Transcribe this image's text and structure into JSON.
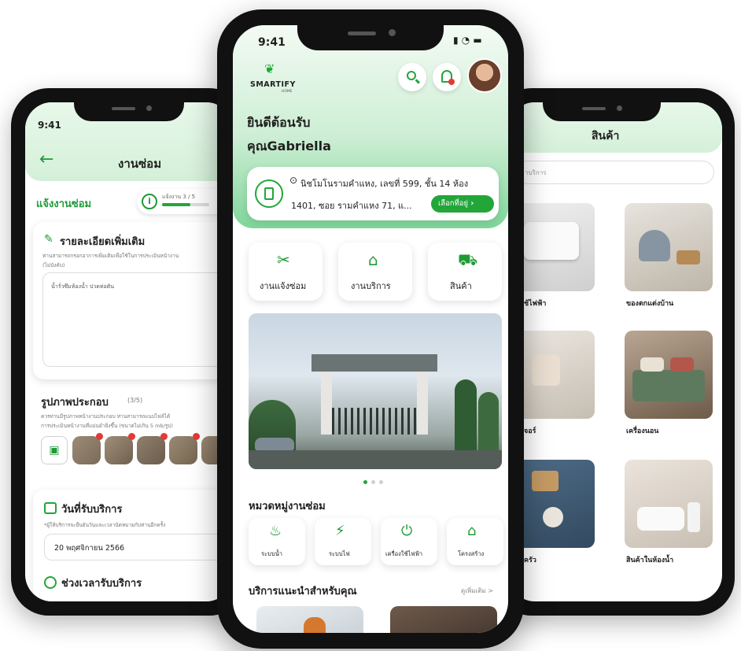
{
  "brand": {
    "name": "SMARTIFY",
    "sub": "HOME",
    "green": "#22a63a",
    "light": "#dff5e3"
  },
  "left": {
    "time": "9:41",
    "title": "งานซ่อม",
    "section": "แจ้งงานซ่อม",
    "step": "แจ้งงาน 3 / 5",
    "detail_title": "รายละเอียดเพิ่มเติม",
    "detail_hint": "ท่านสามารถกรอกอาการเพิ่มเติมเพื่อใช้ในการประเมินหน้างาน",
    "detail_hint2": "(ไม่บังคับ)",
    "detail_value": "น้ำรั่วซึมห้องน้ำ ปวดท่อตัน",
    "photo_title": "รูปภาพประกอบ",
    "photo_count": "(3/5)",
    "photo_hint": "ควรท่านมีรูปภาพหน้างานประกอบ ท่านสามารถแนบไฟล์ได้",
    "photo_hint2": "การประเมินหน้างานที่แม่นยำยิ่งขึ้น (ขนาดไม่เกิน 5 mb/รูป)",
    "date_title": "วันที่รับบริการ",
    "date_hint": "*ผู้ให้บริการจะยืนยันวันและเวลานัดหมายกับท่านอีกครั้ง",
    "date_value": "20 พฤศจิกายน 2566",
    "time_title": "ช่วงเวลารับบริการ",
    "calendar_icon": "calendar-icon",
    "clock_icon": "clock-icon"
  },
  "center": {
    "time": "9:41",
    "welcome": "ยินดีต้อนรับ",
    "user": "คุณGabriella",
    "address_line1": "นิชโมโนรามคำแหง, เลขที่ 599, ชั้น 14 ห้อง",
    "address_line2": "1401, ซอย รามคำแหง 71, แ...",
    "choose_address": "เลือกที่อยู่",
    "menu": [
      {
        "label": "งานแจ้งซ่อม",
        "icon": "tools-icon"
      },
      {
        "label": "งานบริการ",
        "icon": "home-icon"
      },
      {
        "label": "สินค้า",
        "icon": "cart-icon"
      }
    ],
    "category_title": "หมวดหมู่งานซ่อม",
    "categories": [
      {
        "label": "ระบบน้ำ",
        "icon": "faucet-icon"
      },
      {
        "label": "ระบบไฟ",
        "icon": "bulb-icon"
      },
      {
        "label": "เครื่องใช้ไฟฟ้า",
        "icon": "plug-icon"
      },
      {
        "label": "โครงสร้าง",
        "icon": "house-icon"
      }
    ],
    "recommend_title": "บริการแนะนำสำหรับคุณ",
    "see_more": "ดูเพิ่มเติม >"
  },
  "right": {
    "title": "สินค้า",
    "search_placeholder": "าบริการ",
    "products": [
      {
        "label": "ช้ไฟฟ้า"
      },
      {
        "label": "ของตกแต่งบ้าน"
      },
      {
        "label": "จอร์"
      },
      {
        "label": "เครื่องนอน"
      },
      {
        "label": "ครัว"
      },
      {
        "label": "สินค้าในห้องน้ำ"
      }
    ]
  }
}
